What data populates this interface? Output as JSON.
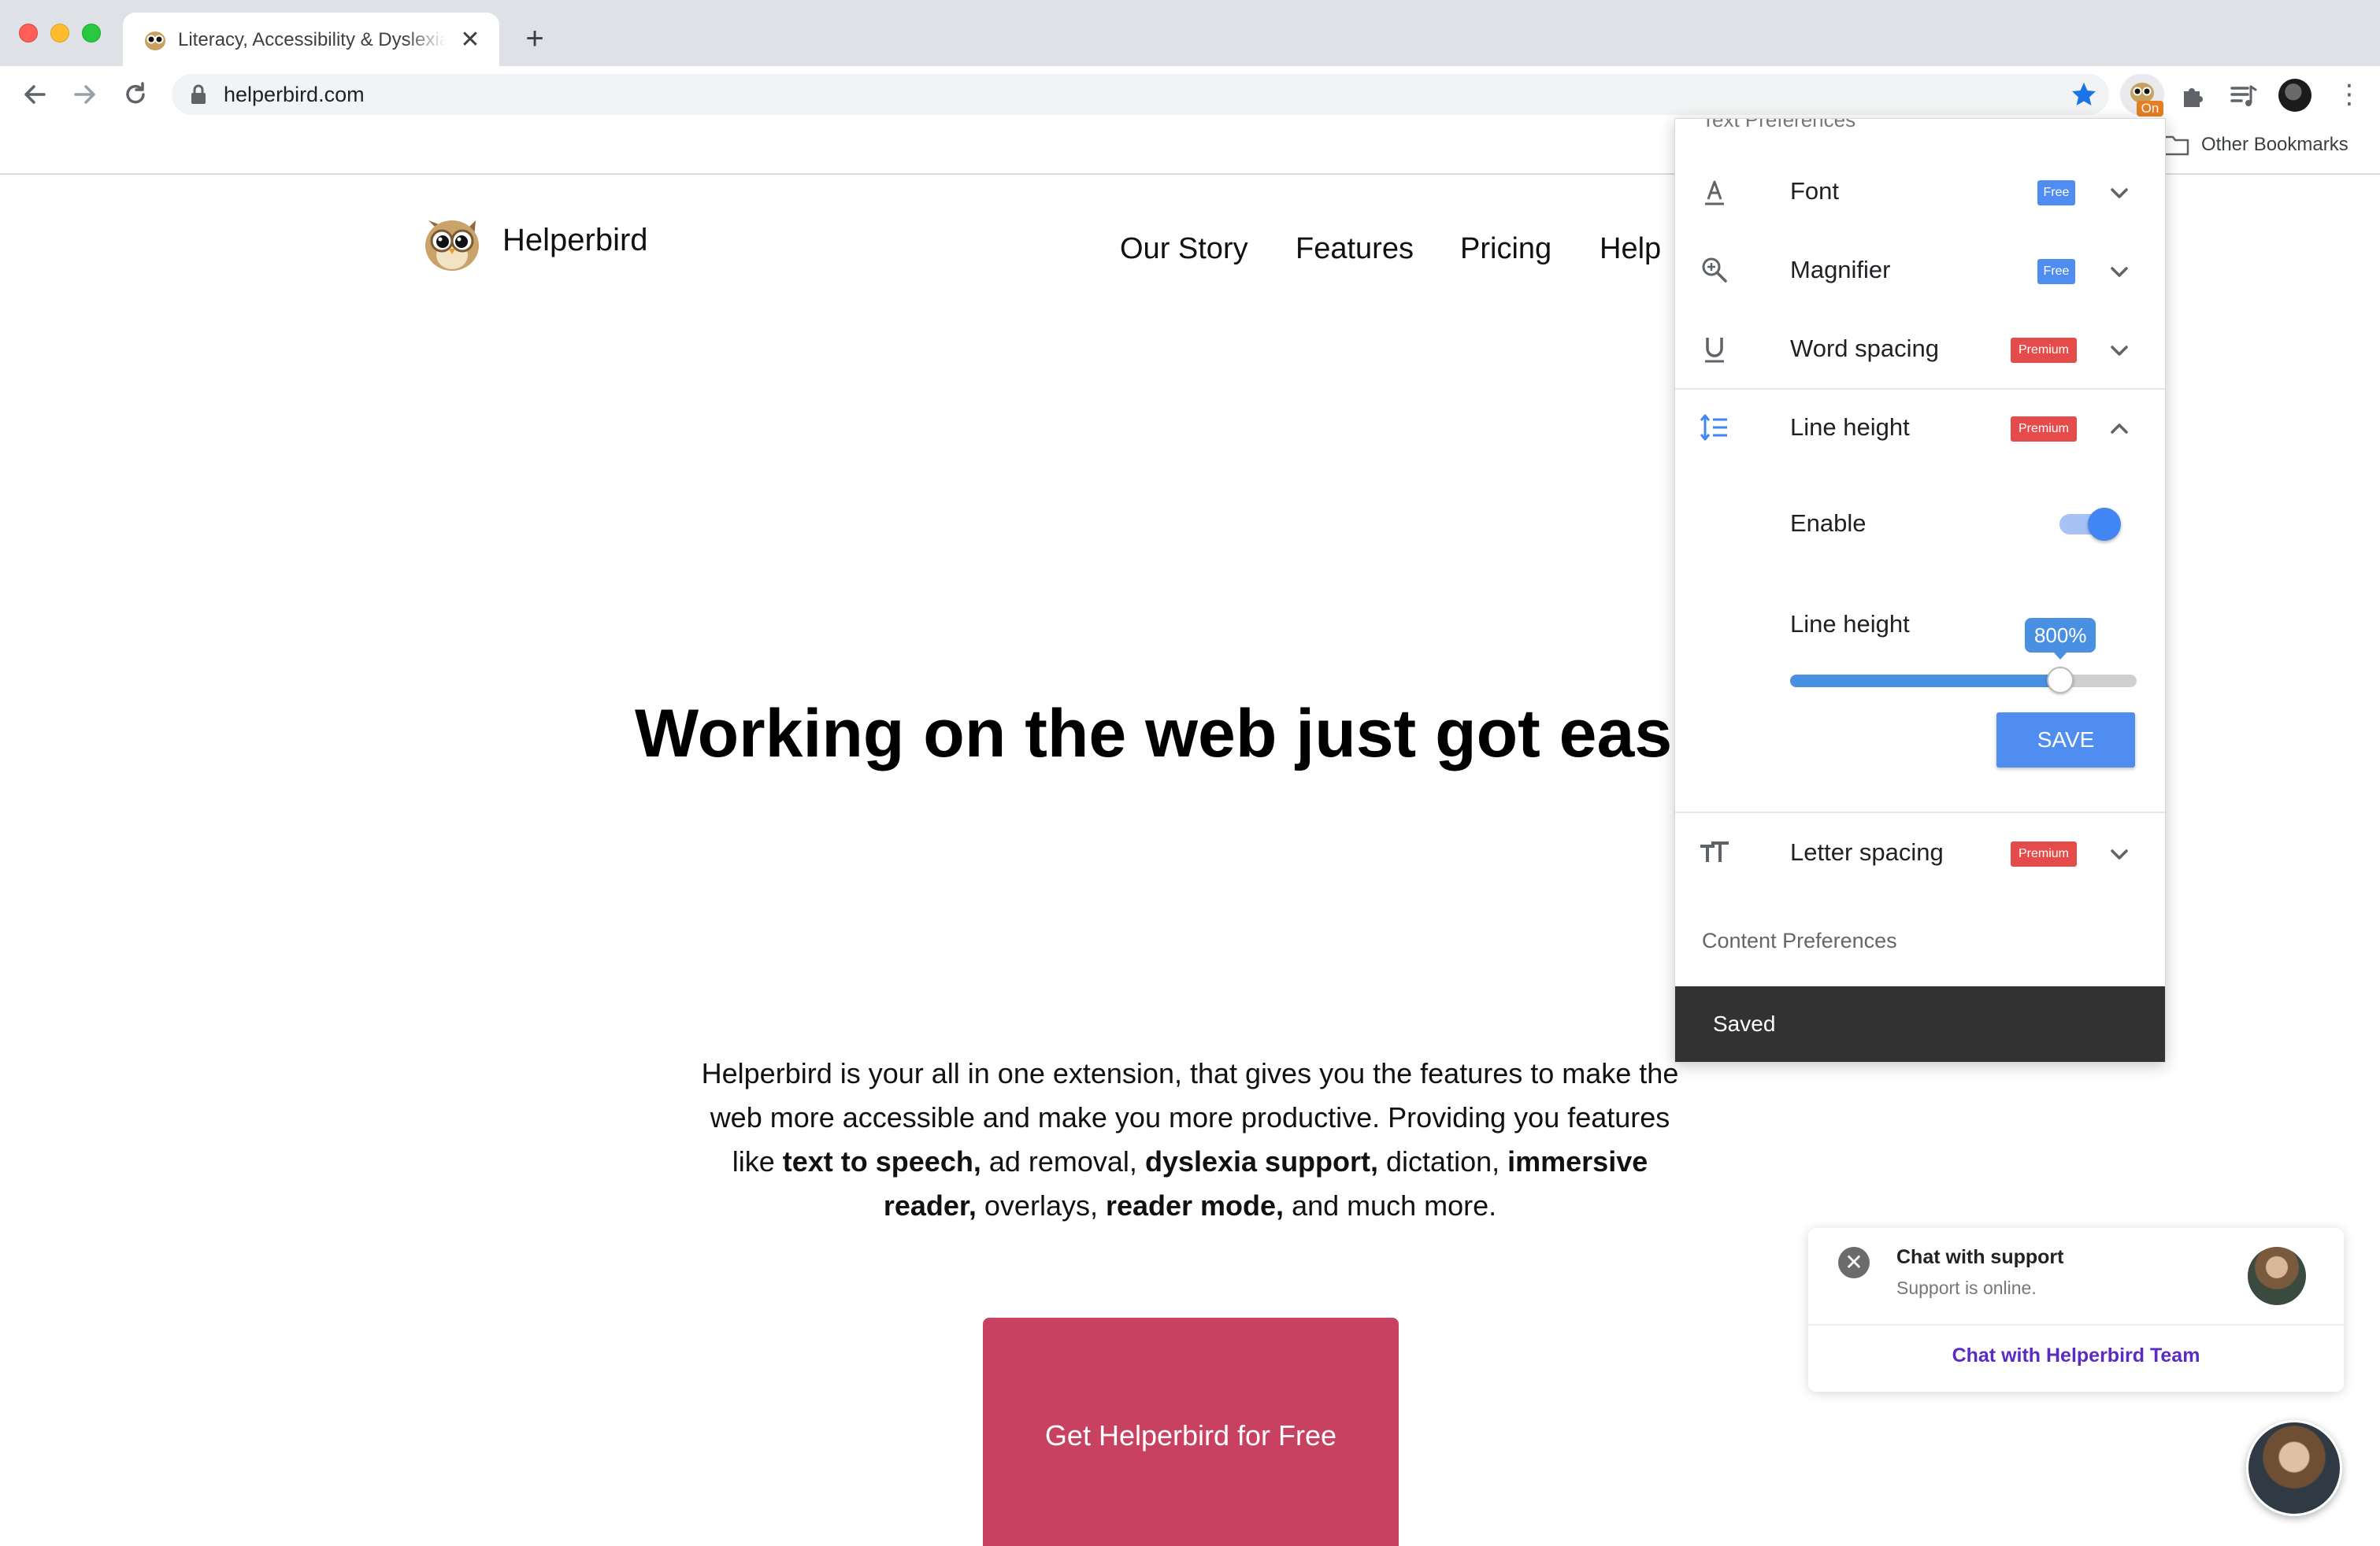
{
  "browser": {
    "tab_title": "Literacy, Accessibility & Dyslexia Support",
    "tab_close": "✕",
    "new_tab": "+",
    "url": "helperbird.com",
    "extension_badge": "On",
    "menu": "⋮",
    "bookmark_folder_label": "Other Bookmarks"
  },
  "site": {
    "brand": "Helperbird",
    "nav": [
      "Our Story",
      "Features",
      "Pricing",
      "Help"
    ],
    "hero": "Working on the web just got easier",
    "blurb": {
      "p1": "Helperbird is your all in one extension, that gives you the features to make the web more accessible and make you more productive. Providing you features like ",
      "b1": "text to speech,",
      "p2": " ad removal, ",
      "b2": "dyslexia support,",
      "p3": " dictation, ",
      "b3": "immersive reader,",
      "p4": " overlays, ",
      "b4": "reader mode,",
      "p5": " and much more."
    },
    "cta": "Get Helperbird for Free"
  },
  "popup": {
    "clipped_heading": "Text Preferences",
    "rows": [
      {
        "label": "Font",
        "badge": "Free",
        "tier": "free",
        "icon": "font-icon",
        "expanded": false
      },
      {
        "label": "Magnifier",
        "badge": "Free",
        "tier": "free",
        "icon": "magnifier-icon",
        "expanded": false
      },
      {
        "label": "Word spacing",
        "badge": "Premium",
        "tier": "premium",
        "icon": "word-spacing-icon",
        "expanded": false
      },
      {
        "label": "Line height",
        "badge": "Premium",
        "tier": "premium",
        "icon": "line-height-icon",
        "expanded": true
      },
      {
        "label": "Letter spacing",
        "badge": "Premium",
        "tier": "premium",
        "icon": "letter-spacing-icon",
        "expanded": false
      }
    ],
    "line_height": {
      "enable_label": "Enable",
      "enabled": true,
      "slider_label": "Line height",
      "value_label": "800%",
      "value_fraction": 0.78,
      "save_label": "SAVE"
    },
    "content_heading": "Content Preferences",
    "snackbar": "Saved"
  },
  "chat": {
    "title": "Chat with support",
    "status": "Support is online.",
    "link": "Chat with Helperbird Team",
    "close": "✕"
  },
  "colors": {
    "accent_blue": "#4f8ef0",
    "premium_red": "#e64b4b",
    "cta_red": "#c94160",
    "chat_purple": "#5b2bc2"
  }
}
